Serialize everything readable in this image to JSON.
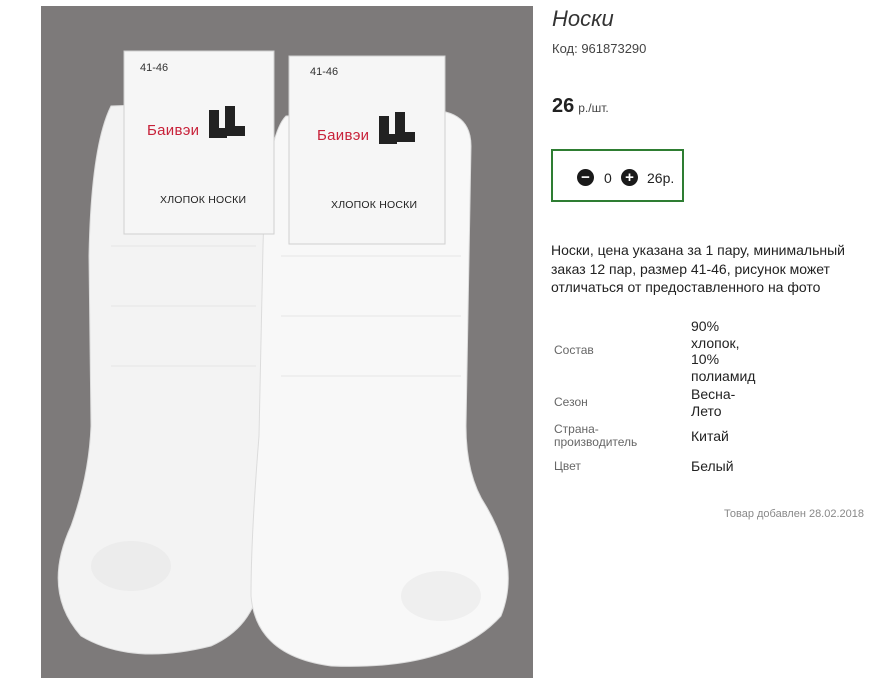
{
  "product": {
    "title": "Носки",
    "code": "Код: 961873290",
    "price_value": "26",
    "price_unit": "р./шт.",
    "quantity": "0",
    "total": "26р.",
    "description": "Носки, цена указана за 1 пару, минимальный заказ 12 пар, размер 41-46, рисунок может отличаться от предоставленного на фото",
    "added": "Товар добавлен 28.02.2018"
  },
  "photo": {
    "tag_left": {
      "size": "41-46",
      "brand": "Баивэи",
      "sub": "ХЛОПОК НОСКИ"
    },
    "tag_right": {
      "size": "41-46",
      "brand": "Баивэи",
      "sub": "ХЛОПОК НОСКИ"
    },
    "background_color": "#7d7a7a",
    "sock_color": "#f7f7f7"
  },
  "specs": [
    {
      "label": "Состав",
      "value": "90% хлопок, 10% полиамид"
    },
    {
      "label": "Сезон",
      "value": "Весна-Лето"
    },
    {
      "label": "Страна-производитель",
      "value": "Китай"
    },
    {
      "label": "Цвет",
      "value": "Белый"
    }
  ],
  "icons": {
    "minus": "minus-circle-icon",
    "plus": "plus-circle-icon"
  },
  "colors": {
    "qty_border": "#2e7d32"
  }
}
